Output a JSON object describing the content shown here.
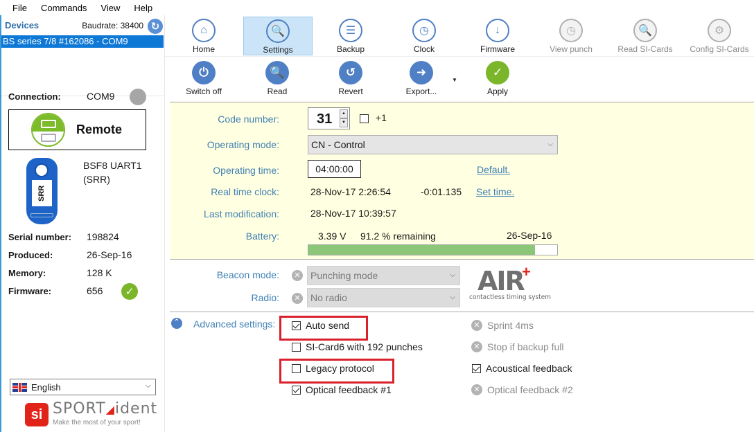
{
  "menu": [
    "File",
    "Commands",
    "View",
    "Help"
  ],
  "devices": {
    "title": "Devices",
    "baudrate": "Baudrate: 38400",
    "refresh_icon": "refresh-icon",
    "items": [
      "BS series 7/8 #162086 - COM9"
    ]
  },
  "connection": {
    "label": "Connection:",
    "value": "COM9",
    "status_color": "#a6a6a6"
  },
  "remote_button": {
    "label": "Remote",
    "accent": "#7dbb2a"
  },
  "device": {
    "image_text": "SRR",
    "name_line1": "BSF8 UART1",
    "name_line2": "(SRR)"
  },
  "info": [
    {
      "key": "Serial number:",
      "value": "198824"
    },
    {
      "key": "Produced:",
      "value": "26-Sep-16"
    },
    {
      "key": "Memory:",
      "value": "128 K"
    },
    {
      "key": "Firmware:",
      "value": "656",
      "status": "ok"
    }
  ],
  "language": {
    "selected": "English",
    "flag": "uk-flag"
  },
  "logo": {
    "mark": "si",
    "name_a": "SPORT",
    "name_b": "ident",
    "tagline": "Make the most of your sport!"
  },
  "toolbar_top": [
    {
      "label": "Home",
      "icon": "home-icon",
      "state": "normal"
    },
    {
      "label": "Settings",
      "icon": "settings-device-icon",
      "state": "active"
    },
    {
      "label": "Backup",
      "icon": "backup-icon",
      "state": "normal"
    },
    {
      "label": "Clock",
      "icon": "clock-icon",
      "state": "normal"
    },
    {
      "label": "Firmware",
      "icon": "firmware-icon",
      "state": "normal"
    },
    {
      "label": "View punch",
      "icon": "view-punch-icon",
      "state": "disabled"
    },
    {
      "label": "Read SI-Cards",
      "icon": "read-si-cards-icon",
      "state": "disabled"
    },
    {
      "label": "Config SI-Cards",
      "icon": "config-si-cards-icon",
      "state": "disabled"
    }
  ],
  "toolbar_actions": [
    {
      "label": "Switch off",
      "icon": "power-icon"
    },
    {
      "label": "Read",
      "icon": "read-icon"
    },
    {
      "label": "Revert",
      "icon": "revert-icon"
    },
    {
      "label": "Export...",
      "icon": "export-icon"
    },
    {
      "label": "Apply",
      "icon": "check-icon"
    }
  ],
  "settings": {
    "code_number": {
      "label": "Code number:",
      "value": "31",
      "plus_one_label": "+1",
      "plus_one_checked": false
    },
    "operating_mode": {
      "label": "Operating mode:",
      "value": "CN - Control"
    },
    "operating_time": {
      "label": "Operating time:",
      "value": "04:00:00",
      "link": "Default."
    },
    "real_time_clock": {
      "label": "Real time clock:",
      "value": "28-Nov-17 2:26:54",
      "offset": "-0:01.135",
      "link": "Set time."
    },
    "last_modification": {
      "label": "Last modification:",
      "value": "28-Nov-17 10:39:57"
    },
    "battery": {
      "label": "Battery:",
      "voltage": "3.39 V",
      "remaining": "91.2 % remaining",
      "date": "26-Sep-16",
      "percent": 91.2,
      "color": "#8cc678"
    }
  },
  "beacon": {
    "mode_label": "Beacon mode:",
    "mode_value": "Punching mode",
    "radio_label": "Radio:",
    "radio_value": "No radio",
    "air_logo": "AIR",
    "air_sub": "contactless timing system"
  },
  "advanced": {
    "label": "Advanced settings:",
    "left": [
      {
        "label": "Auto send",
        "type": "checkbox",
        "checked": true,
        "highlighted": true
      },
      {
        "label": "SI-Card6 with 192 punches",
        "type": "checkbox",
        "checked": false
      },
      {
        "label": "Legacy protocol",
        "type": "checkbox",
        "checked": false,
        "highlighted": true
      },
      {
        "label": "Optical feedback #1",
        "type": "checkbox",
        "checked": true
      }
    ],
    "right": [
      {
        "label": "Sprint 4ms",
        "type": "unavailable"
      },
      {
        "label": "Stop if backup full",
        "type": "unavailable"
      },
      {
        "label": "Acoustical feedback",
        "type": "checkbox",
        "checked": true
      },
      {
        "label": "Optical feedback #2",
        "type": "unavailable"
      }
    ],
    "highlight_color": "#d9202b"
  }
}
